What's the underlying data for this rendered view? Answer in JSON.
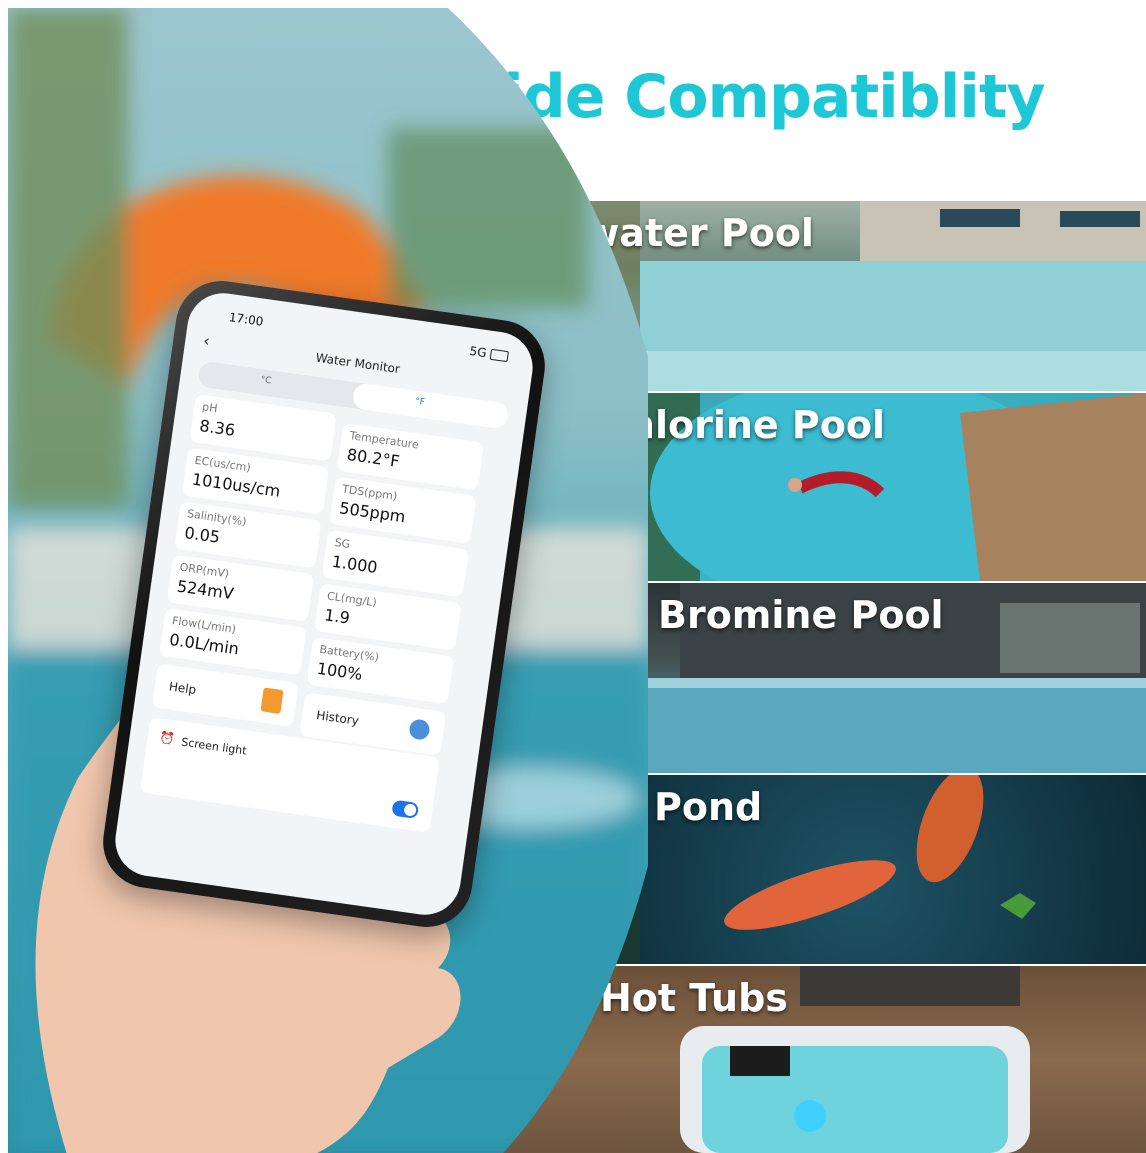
{
  "headline": "Wide Compatiblity",
  "pool_types": [
    {
      "label": "Saltwater Pool"
    },
    {
      "label": "Chlorine Pool"
    },
    {
      "label": "Bromine Pool"
    },
    {
      "label": "Pond"
    },
    {
      "label": "Hot Tubs"
    }
  ],
  "phone": {
    "time": "17:00",
    "network": "5G",
    "title": "Water Monitor",
    "back_icon": "chevron-left-icon",
    "edit_icon": "pencil-icon",
    "unit_celsius": "°C",
    "unit_fahrenheit": "°F",
    "readings": [
      {
        "label": "pH",
        "value": "8.36"
      },
      {
        "label": "Temperature",
        "value": "80.2°F"
      },
      {
        "label": "EC(us/cm)",
        "value": "1010us/cm"
      },
      {
        "label": "TDS(ppm)",
        "value": "505ppm"
      },
      {
        "label": "Salinity(%)",
        "value": "0.05"
      },
      {
        "label": "SG",
        "value": "1.000"
      },
      {
        "label": "ORP(mV)",
        "value": "524mV"
      },
      {
        "label": "CL(mg/L)",
        "value": "1.9"
      },
      {
        "label": "Flow(L/min)",
        "value": "0.0L/min"
      },
      {
        "label": "Battery(%)",
        "value": "100%"
      }
    ],
    "help_label": "Help",
    "history_label": "History",
    "screen_light_label": "Screen light",
    "screen_light_on": true
  },
  "colors": {
    "headline": "#1ec7d6",
    "toggle": "#1a73e8",
    "help_icon": "#f29a2e"
  }
}
